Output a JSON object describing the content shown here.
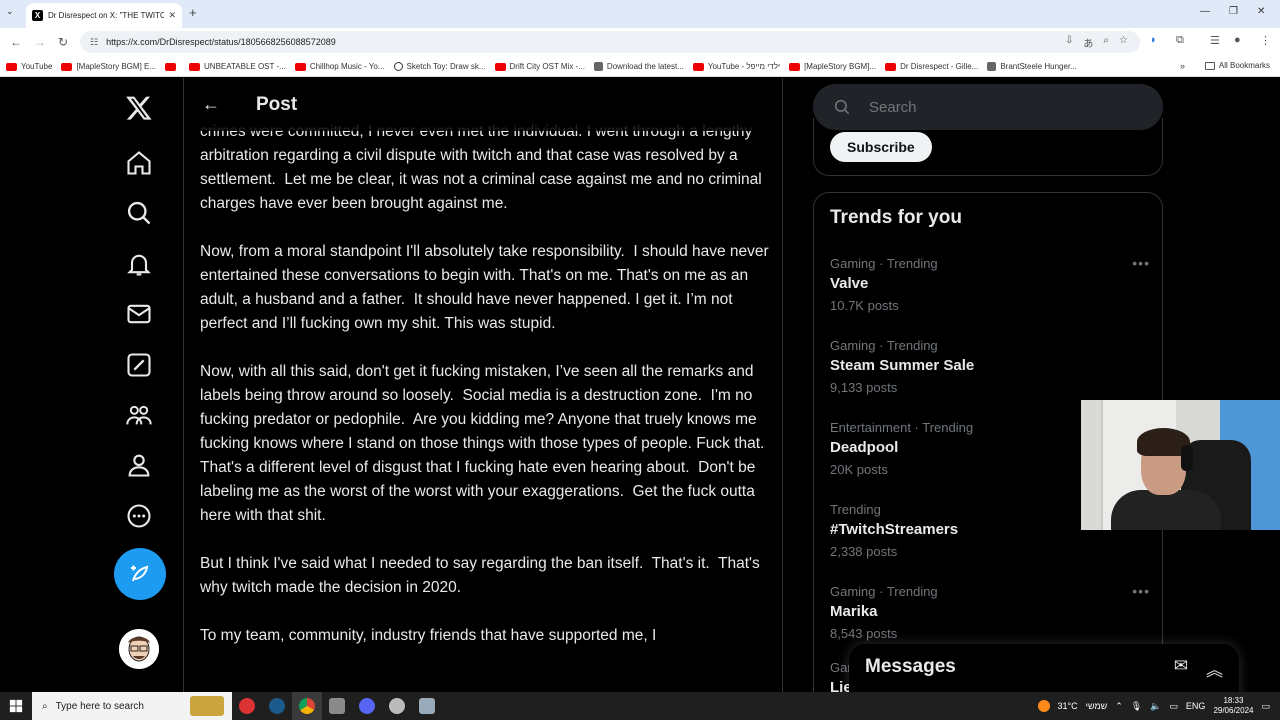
{
  "browser": {
    "tab_title": "Dr Disrespect on X: \"THE TWITC",
    "url": "https://x.com/DrDisrespect/status/1805668256088572089",
    "bookmarks": [
      {
        "label": "YouTube",
        "icon": "yt"
      },
      {
        "label": "[MapleStory BGM] E...",
        "icon": "yt"
      },
      {
        "label": "",
        "icon": "yt"
      },
      {
        "label": "UNBEATABLE OST -...",
        "icon": "yt"
      },
      {
        "label": "Chillhop Music - Yo...",
        "icon": "yt"
      },
      {
        "label": "Sketch Toy: Draw sk...",
        "icon": "ink"
      },
      {
        "label": "Drift City OST Mix -...",
        "icon": "yt"
      },
      {
        "label": "Download the latest...",
        "icon": "gen"
      },
      {
        "label": "YouTube - ילדי מייפל",
        "icon": "yt"
      },
      {
        "label": "[MapleStory BGM]...",
        "icon": "yt"
      },
      {
        "label": "Dr Disrespect - Gille...",
        "icon": "yt"
      },
      {
        "label": "BrantSteele Hunger...",
        "icon": "gen"
      }
    ],
    "all_bookmarks": "All Bookmarks"
  },
  "post": {
    "header_title": "Post",
    "paragraphs": [
      "crimes were committed, I never even met the individual. I went through a lengthy arbitration regarding a civil dispute with twitch and that case was resolved by a settlement.  Let me be clear, it was not a criminal case against me and no criminal charges have ever been brought against me.",
      "Now, from a moral standpoint I'll absolutely take responsibility.  I should have never entertained these conversations to begin with. That's on me. That's on me as an adult, a husband and a father.  It should have never happened. I get it. I’m not perfect and I’ll fucking own my shit. This was stupid.",
      "Now, with all this said, don't get it fucking mistaken, I’ve seen all the remarks and labels being throw around so loosely.  Social media is a destruction zone.  I'm no fucking predator or pedophile.  Are you kidding me? Anyone that truely knows me fucking knows where I stand on those things with those types of people. Fuck that.  That's a different level of disgust that I fucking hate even hearing about.  Don't be labeling me as the worst of the worst with your exaggerations.  Get the fuck outta here with that shit.",
      "But I think I've said what I needed to say regarding the ban itself.  That's it.  That's why twitch made the decision in 2020.",
      "To my team, community, industry friends that have supported me, I"
    ]
  },
  "sidebar": {
    "search_placeholder": "Search",
    "subscribe_label": "Subscribe",
    "trends_title": "Trends for you",
    "trends": [
      {
        "meta": "Gaming · Trending",
        "name": "Valve",
        "count": "10.7K posts",
        "more": true
      },
      {
        "meta": "Gaming · Trending",
        "name": "Steam Summer Sale",
        "count": "9,133 posts",
        "more": false
      },
      {
        "meta": "Entertainment · Trending",
        "name": "Deadpool",
        "count": "20K posts",
        "more": false
      },
      {
        "meta": "Trending",
        "name": "#TwitchStreamers",
        "count": "2,338 posts",
        "more": true
      },
      {
        "meta": "Gaming · Trending",
        "name": "Marika",
        "count": "8,543 posts",
        "more": true
      },
      {
        "meta": "Gar",
        "name": "Lie",
        "count": "",
        "more": false
      }
    ]
  },
  "messages": {
    "title": "Messages"
  },
  "taskbar": {
    "search_placeholder": "Type here to search",
    "temperature": "31°C",
    "weather_label": "שמשי",
    "lang": "ENG",
    "time": "18:33",
    "date": "29/06/2024"
  },
  "colors": {
    "accent": "#1d9bf0",
    "text": "#e7e9ea",
    "muted": "#71767b",
    "border": "#2f3336"
  }
}
